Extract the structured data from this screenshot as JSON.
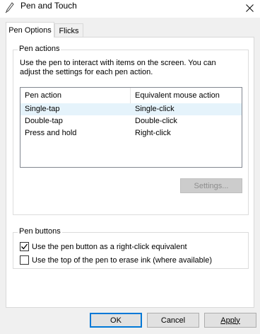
{
  "window": {
    "title": "Pen and Touch",
    "close_icon": "close-icon",
    "app_icon": "pen-icon"
  },
  "tabs": [
    {
      "label": "Pen Options",
      "active": true
    },
    {
      "label": "Flicks",
      "active": false
    }
  ],
  "pen_actions": {
    "legend": "Pen actions",
    "description": "Use the pen to interact with items on the screen.  You can adjust the settings for each pen action.",
    "columns": [
      "Pen action",
      "Equivalent mouse action"
    ],
    "rows": [
      {
        "action": "Single-tap",
        "mouse": "Single-click",
        "selected": true
      },
      {
        "action": "Double-tap",
        "mouse": "Double-click",
        "selected": false
      },
      {
        "action": "Press and hold",
        "mouse": "Right-click",
        "selected": false
      }
    ],
    "settings_button": "Settings..."
  },
  "pen_buttons": {
    "legend": "Pen buttons",
    "options": [
      {
        "label": "Use the pen button as a right-click equivalent",
        "checked": true
      },
      {
        "label": "Use the top of the pen to erase ink (where available)",
        "checked": false
      }
    ]
  },
  "footer": {
    "ok": "OK",
    "cancel": "Cancel",
    "apply": "Apply"
  },
  "colors": {
    "selection": "#e5f3fb",
    "default_button_border": "#0078d7"
  }
}
